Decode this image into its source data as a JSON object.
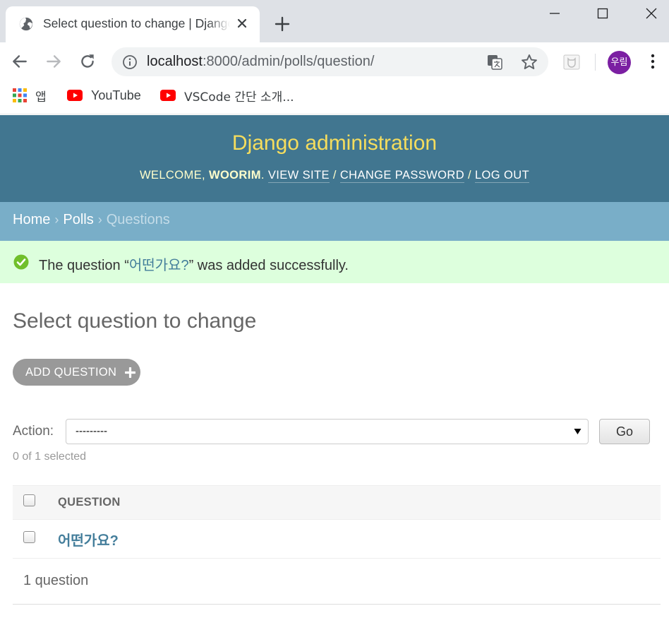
{
  "browser": {
    "tab_title": "Select question to change | Django site admin",
    "url_host": "localhost",
    "url_path": ":8000/admin/polls/question/",
    "avatar_label": "우림",
    "bookmarks": [
      {
        "label": "앱",
        "icon": "apps-grid-icon"
      },
      {
        "label": "YouTube",
        "icon": "youtube-icon"
      },
      {
        "label": "VSCode 간단 소개...",
        "icon": "youtube-icon"
      }
    ]
  },
  "admin": {
    "site_name": "Django administration",
    "user_tools": {
      "welcome": "Welcome,",
      "username": "woorim",
      "view_site": "View site",
      "change_password": "Change password",
      "log_out": "Log out"
    },
    "breadcrumbs": {
      "home": "Home",
      "app": "Polls",
      "current": "Questions"
    },
    "message": {
      "prefix": "The question “",
      "object": "어떤가요?",
      "suffix": "” was added successfully."
    },
    "page_title": "Select question to change",
    "add_button": "ADD QUESTION",
    "actions": {
      "label": "Action:",
      "selected_value": "---------",
      "go_label": "Go",
      "selected_count": "0 of 1 selected"
    },
    "table": {
      "column_header": "QUESTION",
      "rows": [
        {
          "question": "어떤가요?"
        }
      ]
    },
    "paginator": "1 question"
  },
  "colors": {
    "header_bg": "#417690",
    "branding": "#f5dd5d",
    "breadcrumbs_bg": "#79aec8",
    "success_bg": "#ddffdd",
    "link": "#447e9b",
    "avatar_bg": "#7b1fa2"
  }
}
